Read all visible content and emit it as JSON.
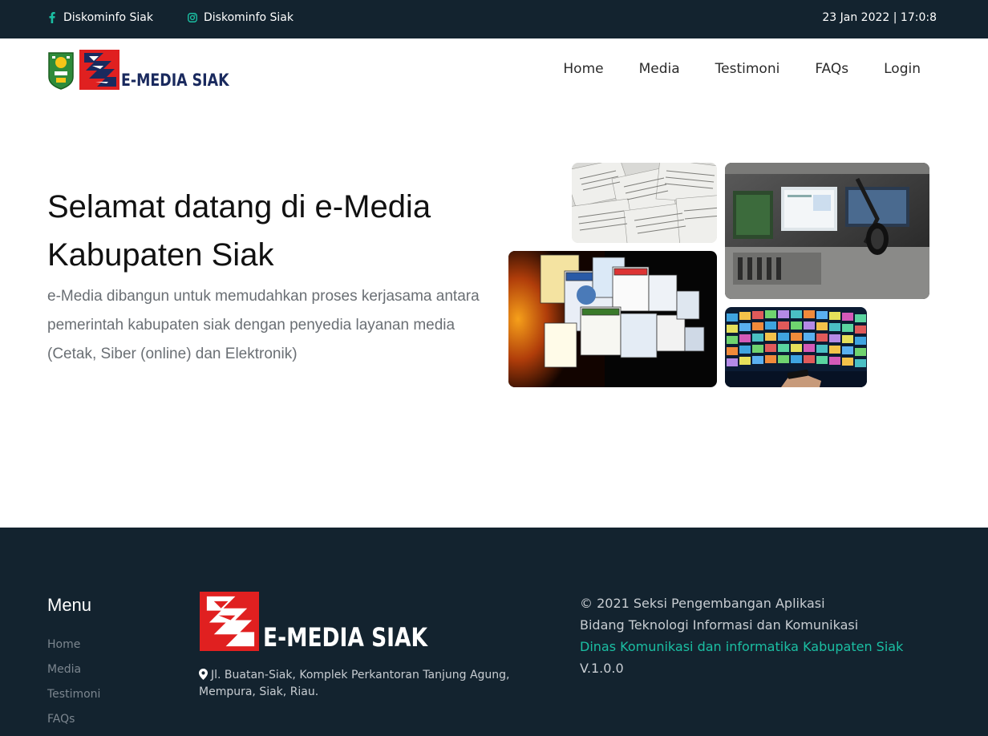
{
  "topbar": {
    "facebook_label": "Diskominfo Siak",
    "instagram_label": "Diskominfo Siak",
    "datetime": "23 Jan 2022 | 17:0:8"
  },
  "header": {
    "brand": "E-MEDIA SIAK",
    "nav": [
      "Home",
      "Media",
      "Testimoni",
      "FAQs",
      "Login"
    ]
  },
  "hero": {
    "title": "Selamat datang di e-Media Kabupaten Siak",
    "description": "e-Media dibangun untuk memudahkan proses kerjasama antara pemerintah kabupaten siak dengan penyedia layanan media (Cetak, Siber (online) dan Elektronik)"
  },
  "footer": {
    "menu_title": "Menu",
    "menu": [
      "Home",
      "Media",
      "Testimoni",
      "FAQs"
    ],
    "brand": "E-MEDIA SIAK",
    "address": "Jl. Buatan-Siak, Komplek Perkantoran Tanjung Agung, Mempura, Siak, Riau.",
    "copyright": "© 2021 Seksi Pengembangan Aplikasi",
    "division": "Bidang Teknologi Informasi dan Komunikasi",
    "agency": "Dinas Komunikasi dan informatika Kabupaten Siak",
    "version": "V.1.0.0"
  },
  "colors": {
    "dark_navy": "#13232f",
    "accent_teal": "#1bbfa3",
    "brand_red": "#e02020",
    "brand_blue": "#1a2a5e"
  },
  "icons": [
    "facebook-icon",
    "instagram-icon",
    "map-pin-icon"
  ]
}
